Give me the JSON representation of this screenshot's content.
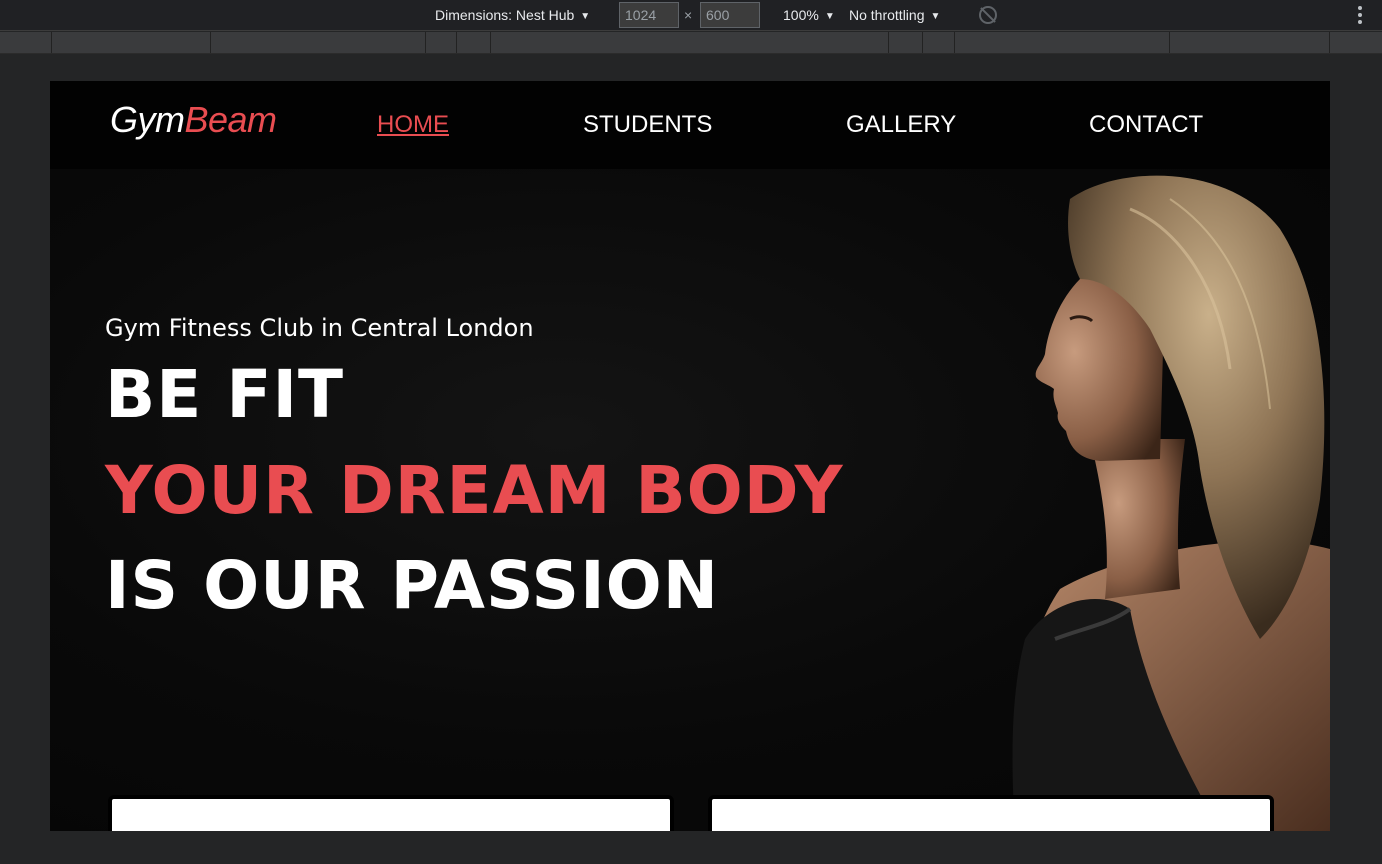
{
  "devtools": {
    "dimensions_label": "Dimensions: Nest Hub",
    "width_value": "1024",
    "times_symbol": "×",
    "height_value": "600",
    "zoom_label": "100%",
    "throttling_label": "No throttling",
    "caret": "▼"
  },
  "site": {
    "logo_part1": "Gym",
    "logo_part2": "Beam",
    "nav": {
      "home": "HOME",
      "students": "STUDENTS",
      "gallery": "GALLERY",
      "contact": "CONTACT"
    },
    "hero": {
      "tagline": "Gym Fitness Club in Central London",
      "line1": "BE FIT",
      "line2": "YOUR DREAM BODY",
      "line3": "IS OUR PASSION"
    },
    "colors": {
      "accent": "#e94d51",
      "background": "#060606",
      "text": "#ffffff"
    }
  }
}
